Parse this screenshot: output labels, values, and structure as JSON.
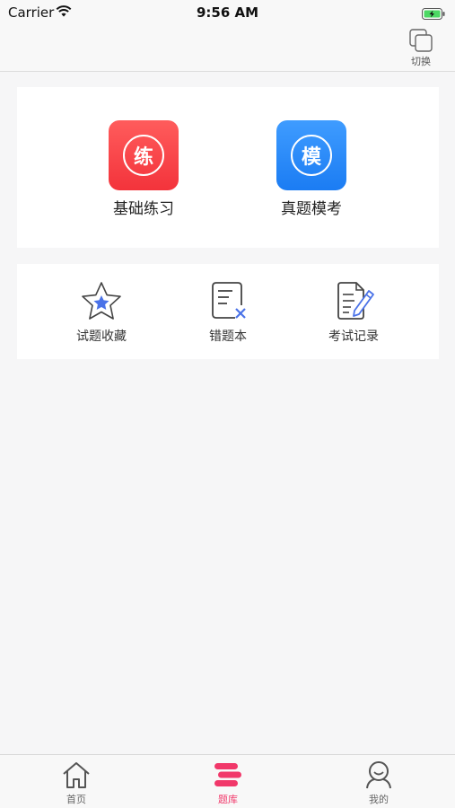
{
  "status_bar": {
    "carrier": "Carrier",
    "time": "9:56 AM",
    "wifi_icon": "wifi-icon",
    "battery_icon": "battery-charging-icon"
  },
  "nav": {
    "switch_label": "切换",
    "switch_icon": "switch-copy-icon"
  },
  "main_entries": [
    {
      "label": "基础练习",
      "glyph": "练",
      "color": "#f5383f"
    },
    {
      "label": "真题模考",
      "glyph": "模",
      "color": "#2185f6"
    }
  ],
  "tools": [
    {
      "label": "试题收藏",
      "icon": "star-icon"
    },
    {
      "label": "错题本",
      "icon": "wrong-notebook-icon"
    },
    {
      "label": "考试记录",
      "icon": "exam-record-icon"
    }
  ],
  "tab_bar": {
    "tabs": [
      {
        "label": "首页",
        "icon": "home-icon",
        "active": false
      },
      {
        "label": "题库",
        "icon": "question-bank-icon",
        "active": true
      },
      {
        "label": "我的",
        "icon": "user-icon",
        "active": false
      }
    ],
    "active_color": "#f1386a"
  },
  "colors": {
    "accent_blue": "#4a72e8",
    "background": "#f6f6f7"
  }
}
